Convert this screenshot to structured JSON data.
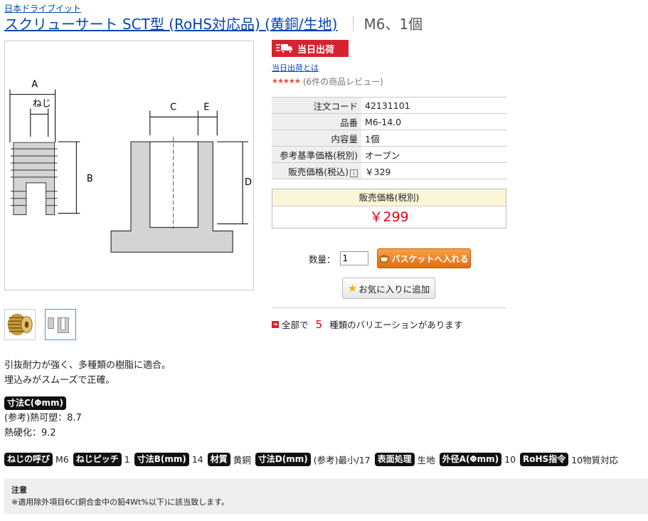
{
  "brand": "日本ドライブイット",
  "title": "スクリューサート SCT型 (RoHS対応品) (黄銅/生地)",
  "subtitle": "M6、1個",
  "diagram_labels": {
    "a": "A",
    "neji": "ねじ",
    "b": "B",
    "c": "C",
    "e": "E",
    "d": "D"
  },
  "shipping": {
    "badge": "当日出荷",
    "link": "当日出荷とは"
  },
  "rating": {
    "stars": "★★★★★",
    "text": "(6件の商品レビュー)"
  },
  "spec_rows": [
    {
      "label": "注文コード",
      "value": "42131101"
    },
    {
      "label": "品番",
      "value": "M6-14.0"
    },
    {
      "label": "内容量",
      "value": "1個"
    },
    {
      "label": "参考基準価格(税別)",
      "value": "オープン"
    },
    {
      "label": "販売価格(税込)",
      "value": "￥329"
    }
  ],
  "price_box": {
    "label": "販売価格(税別)",
    "value": "￥299"
  },
  "cart": {
    "qty_label": "数量：",
    "qty_value": "1",
    "button": "バスケットへ入れる"
  },
  "favorite_button": "お気に入りに追加",
  "variation": {
    "prefix": "全部で",
    "count": "5",
    "suffix": "種類のバリエーションがあります"
  },
  "description": [
    "引抜耐力が強く、多種類の樹脂に適合。",
    "埋込みがスムーズで正確。"
  ],
  "dimension_c": {
    "tag": "寸法C(Φmm)",
    "lines": [
      "(参考)熱可塑：8.7",
      "熱硬化：9.2"
    ]
  },
  "attributes": [
    {
      "tag": "ねじの呼び",
      "value": "M6"
    },
    {
      "tag": "ねじピッチ",
      "value": "1"
    },
    {
      "tag": "寸法B(mm)",
      "value": "14"
    },
    {
      "tag": "材質",
      "value": "黄銅"
    },
    {
      "tag": "寸法D(mm)",
      "value": "(参考)最小/17"
    },
    {
      "tag": "表面処理",
      "value": "生地"
    },
    {
      "tag": "外径A(Φmm)",
      "value": "10"
    },
    {
      "tag": "RoHS指令",
      "value": "10物質対応"
    }
  ],
  "notice": {
    "title": "注意",
    "text": "※適用除外項目6C(銅合金中の鉛4Wt%以下)に該当致します。"
  },
  "colors": {
    "link": "#0645ad",
    "price_red": "#e60012",
    "badge_red": "#d6232f",
    "cart_orange": "#e26a10"
  }
}
